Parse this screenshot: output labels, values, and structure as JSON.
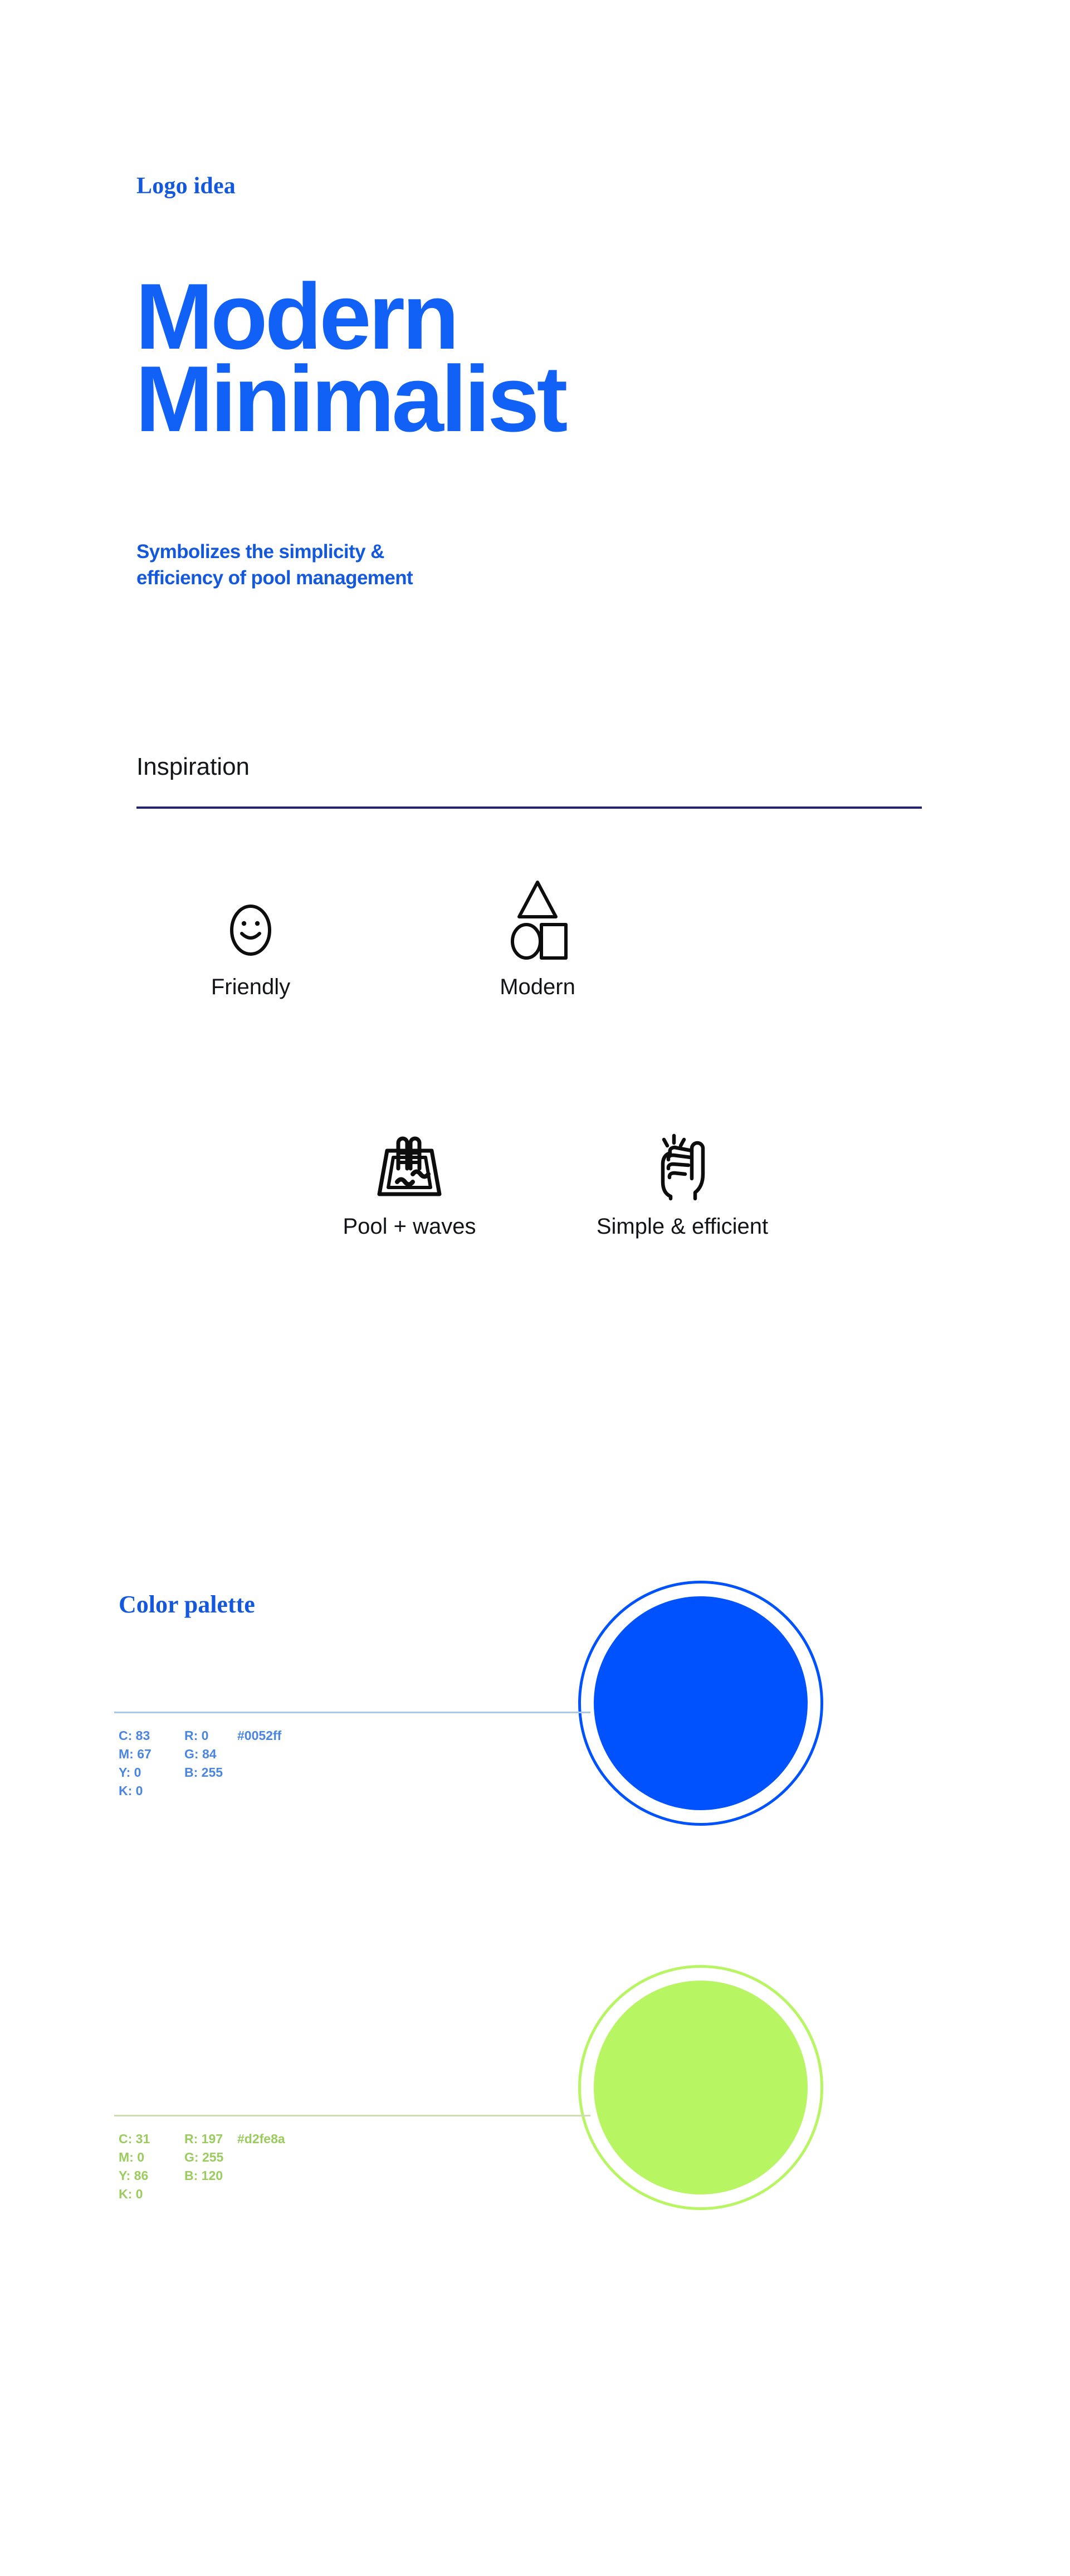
{
  "branding": {
    "eyebrow": "Logo idea",
    "headline_line1": "Modern",
    "headline_line2": "Minimalist",
    "subhead_line1": "Symbolizes the simplicity &",
    "subhead_line2": "efficiency of pool management",
    "headline_color": "#1161f7",
    "eyebrow_color": "#1459dd"
  },
  "inspiration": {
    "title": "Inspiration",
    "rule_color": "#22236a",
    "items": [
      {
        "label": "Friendly",
        "icon": "smiley-face-icon"
      },
      {
        "label": "Modern",
        "icon": "geometric-shapes-icon"
      },
      {
        "label": "Pool + waves",
        "icon": "swimming-pool-icon"
      },
      {
        "label": "Simple & efficient",
        "icon": "pointing-hand-icon"
      }
    ]
  },
  "color_palette": {
    "title": "Color palette",
    "swatches": [
      {
        "hex": "#0052ff",
        "hex_label": "#0052ff",
        "text_color": "#4a86e0",
        "rule_color": "#a9c8e8",
        "cmyk": [
          {
            "key": "C",
            "value": "83"
          },
          {
            "key": "M",
            "value": "67"
          },
          {
            "key": "Y",
            "value": "0"
          },
          {
            "key": "K",
            "value": "0"
          }
        ],
        "rgb": [
          {
            "key": "R",
            "value": "0"
          },
          {
            "key": "G",
            "value": "84"
          },
          {
            "key": "B",
            "value": "255"
          }
        ],
        "cmyk_lines": [
          "C: 83",
          "M: 67",
          "Y: 0",
          "K: 0"
        ],
        "rgb_lines": [
          "R: 0",
          "G: 84",
          "B: 255"
        ]
      },
      {
        "hex": "#b8f563",
        "hex_label": "#d2fe8a",
        "text_color": "#9acc5e",
        "rule_color": "#cfdcb4",
        "cmyk": [
          {
            "key": "C",
            "value": "31"
          },
          {
            "key": "M",
            "value": "0"
          },
          {
            "key": "Y",
            "value": "86"
          },
          {
            "key": "K",
            "value": "0"
          }
        ],
        "rgb": [
          {
            "key": "R",
            "value": "197"
          },
          {
            "key": "G",
            "value": "255"
          },
          {
            "key": "B",
            "value": "120"
          }
        ],
        "cmyk_lines": [
          "C: 31",
          "M: 0",
          "Y: 86",
          "K: 0"
        ],
        "rgb_lines": [
          "R: 197",
          "G: 255",
          "B: 120"
        ]
      }
    ]
  }
}
